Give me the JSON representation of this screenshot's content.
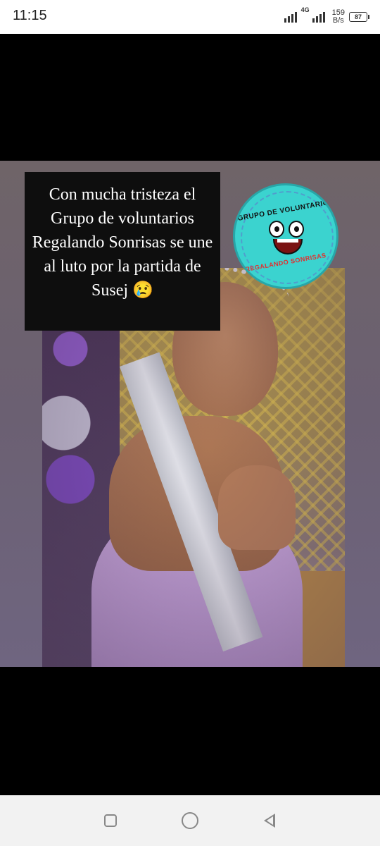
{
  "status_bar": {
    "time": "11:15",
    "network_type": "4G",
    "speed_value": "159",
    "speed_unit": "B/s",
    "battery": "87"
  },
  "post": {
    "caption": "Con mucha tristeza el Grupo de voluntarios Regalando Sonrisas se une al luto por la partida de Susej 😢",
    "logo": {
      "top_text": "GRUPO DE VOLUNTARIOS",
      "bottom_text": "REGALANDO SONRISAS"
    }
  },
  "nav_bar": {
    "buttons": [
      "recent-apps",
      "home",
      "back"
    ]
  },
  "colors": {
    "caption_bg": "#0e0e0e",
    "logo_bg": "#3bd3cf",
    "logo_bottom_text": "#e03030"
  }
}
